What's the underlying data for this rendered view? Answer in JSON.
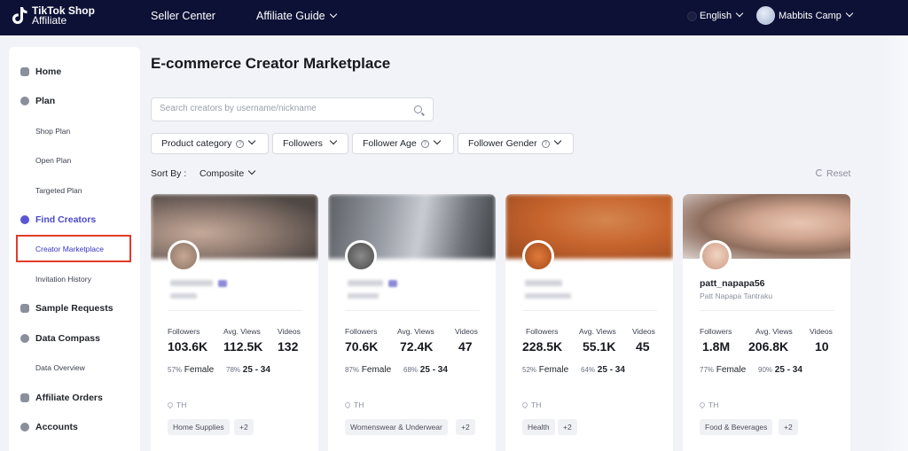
{
  "brand": {
    "line1": "TikTok Shop",
    "line2": "Affiliate"
  },
  "nav": {
    "seller_center": "Seller Center",
    "affiliate_guide": "Affiliate Guide",
    "language": "English",
    "user": "Mabbits Camp"
  },
  "sidebar": {
    "home": "Home",
    "plan": "Plan",
    "shop_plan": "Shop Plan",
    "open_plan": "Open Plan",
    "targeted_plan": "Targeted Plan",
    "find_creators": "Find Creators",
    "creator_marketplace": "Creator Marketplace",
    "invitation_history": "Invitation History",
    "sample_requests": "Sample Requests",
    "data_compass": "Data Compass",
    "data_overview": "Data Overview",
    "affiliate_orders": "Affiliate Orders",
    "accounts": "Accounts"
  },
  "page": {
    "title": "E-commerce Creator Marketplace"
  },
  "search": {
    "placeholder": "Search creators by username/nickname"
  },
  "filters": {
    "product_category": "Product category",
    "followers": "Followers",
    "follower_age": "Follower Age",
    "follower_gender": "Follower Gender"
  },
  "sort": {
    "label": "Sort By :",
    "value": "Composite",
    "reset": "Reset"
  },
  "stat_labels": {
    "followers": "Followers",
    "avg_views": "Avg. Views",
    "videos": "Videos"
  },
  "cards": [
    {
      "followers": "103.6K",
      "avg_views": "112.5K",
      "videos": "132",
      "female_pct": "57%",
      "gender": "Female",
      "age_pct": "78%",
      "age": "25 - 34",
      "location": "TH",
      "tag": "Home Supplies",
      "more": "+2"
    },
    {
      "followers": "70.6K",
      "avg_views": "72.4K",
      "videos": "47",
      "female_pct": "87%",
      "gender": "Female",
      "age_pct": "68%",
      "age": "25 - 34",
      "location": "TH",
      "tag": "Womenswear & Underwear",
      "more": "+2"
    },
    {
      "followers": "228.5K",
      "avg_views": "55.1K",
      "videos": "45",
      "female_pct": "52%",
      "gender": "Female",
      "age_pct": "64%",
      "age": "25 - 34",
      "location": "TH",
      "tag": "Health",
      "more": "+2"
    },
    {
      "handle": "patt_napapa56",
      "name": "Patt Napapa Tantraku",
      "followers": "1.8M",
      "avg_views": "206.8K",
      "videos": "10",
      "female_pct": "77%",
      "gender": "Female",
      "age_pct": "90%",
      "age": "25 - 34",
      "location": "TH",
      "tag": "Food & Beverages",
      "more": "+2"
    }
  ],
  "colors": {
    "topbar": "#0d1136",
    "accent": "#4b48c8",
    "highlight": "#e23b2a"
  }
}
